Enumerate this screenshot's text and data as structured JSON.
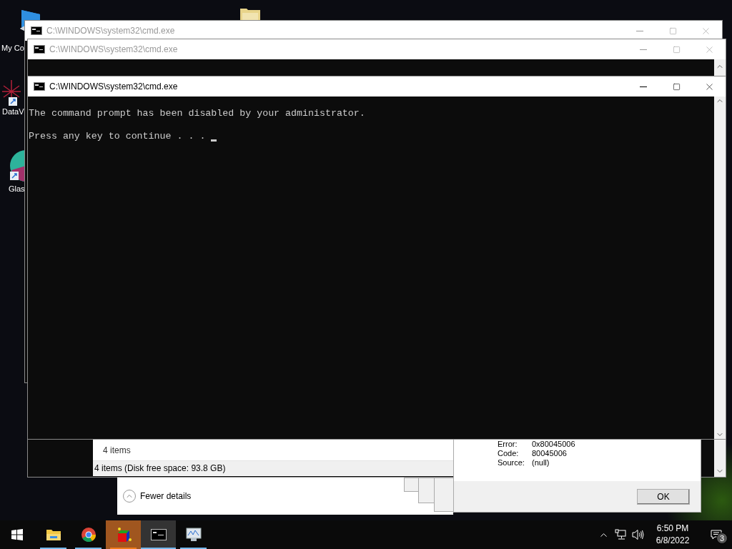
{
  "desktop_icons": [
    {
      "label": "My Co",
      "kind": "computer"
    },
    {
      "label": "DataV",
      "kind": "datav"
    },
    {
      "label": "Glas",
      "kind": "glass"
    }
  ],
  "windows": [
    {
      "title": "C:\\WINDOWS\\system32\\cmd.exe",
      "active": false
    },
    {
      "title": "C:\\WINDOWS\\system32\\cmd.exe",
      "active": false
    },
    {
      "title": "C:\\WINDOWS\\system32\\cmd.exe",
      "active": true,
      "lines": [
        "The command prompt has been disabled by your administrator.",
        "Press any key to continue . . ."
      ]
    }
  ],
  "explorer_status": {
    "count": "4 items",
    "disk": "4 items (Disk free space: 93.8 GB)"
  },
  "details_toggle": "Fewer details",
  "error_dialog": {
    "fields": [
      {
        "label": "Error:",
        "value": "0x80045006"
      },
      {
        "label": "Code:",
        "value": "80045006"
      },
      {
        "label": "Source:",
        "value": "(null)"
      }
    ],
    "button": "OK"
  },
  "taskbar": {
    "apps": [
      {
        "kind": "explorer",
        "selected": false,
        "flashing": false
      },
      {
        "kind": "chrome",
        "selected": false,
        "flashing": false
      },
      {
        "kind": "tool",
        "selected": false,
        "flashing": true
      },
      {
        "kind": "cmd",
        "selected": true,
        "flashing": false
      },
      {
        "kind": "monitor",
        "selected": false,
        "flashing": false
      }
    ],
    "time": "6:50 PM",
    "date": "6/8/2022",
    "notifications": "3"
  }
}
